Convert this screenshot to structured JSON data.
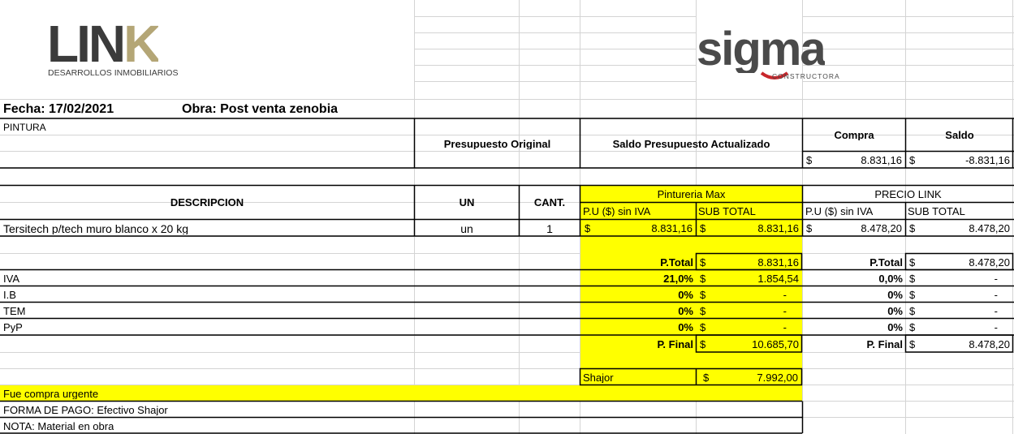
{
  "logos": {
    "link_name": "LIN",
    "link_k": "K",
    "link_sub": "DESARROLLOS INMOBILIARIOS",
    "sigma_name": "sigma",
    "sigma_sub": "CONSTRUCTORA"
  },
  "header": {
    "fecha": "Fecha: 17/02/2021",
    "obra": "Obra:  Post venta zenobia",
    "rubro": "PINTURA"
  },
  "budget": {
    "original_label": "Presupuesto Original",
    "actualizado_label": "Saldo Presupuesto Actualizado",
    "compra_label": "Compra",
    "saldo_label": "Saldo",
    "currency": "$",
    "compra_value": "8.831,16",
    "saldo_value": "-8.831,16"
  },
  "table": {
    "col_desc": "DESCRIPCION",
    "col_un": "UN",
    "col_cant": "CANT.",
    "vendor_name": "Pintureria Max",
    "link_name": "PRECIO LINK",
    "pu_label": "P.U ($) sin IVA",
    "sub_label": "SUB TOTAL",
    "item": {
      "desc": "Tersitech p/tech muro blanco x 20 kg",
      "un": "un",
      "cant": "1",
      "vendor_pu": "8.831,16",
      "vendor_sub": "8.831,16",
      "link_pu": "8.478,20",
      "link_sub": "8.478,20"
    }
  },
  "totals": {
    "ptotal_label": "P.Total",
    "vendor_ptotal": "8.831,16",
    "link_ptotal": "8.478,20",
    "rows": [
      {
        "label": "IVA",
        "vendor_pct": "21,0%",
        "vendor_val": "1.854,54",
        "link_pct": "0,0%",
        "link_val": "-"
      },
      {
        "label": "I.B",
        "vendor_pct": "0%",
        "vendor_val": "-",
        "link_pct": "0%",
        "link_val": "-"
      },
      {
        "label": "TEM",
        "vendor_pct": "0%",
        "vendor_val": "-",
        "link_pct": "0%",
        "link_val": "-"
      },
      {
        "label": "PyP",
        "vendor_pct": "0%",
        "vendor_val": "-",
        "link_pct": "0%",
        "link_val": "-"
      }
    ],
    "pfinal_label": "P. Final",
    "vendor_pfinal": "10.685,70",
    "link_pfinal": "8.478,20",
    "shajor_label": "Shajor",
    "shajor_value": "7.992,00"
  },
  "notes": {
    "urgent": "Fue compra urgente",
    "pago": "FORMA DE PAGO: Efectivo Shajor",
    "nota": "NOTA: Material en obra"
  },
  "colors": {
    "highlight": "#ffff00",
    "gridline": "#d4d4d4",
    "border": "#000000",
    "link_gold": "#b4a676",
    "link_dark": "#3b3b3b",
    "sigma_red": "#c8262b",
    "sigma_gray": "#4a4a4a"
  }
}
